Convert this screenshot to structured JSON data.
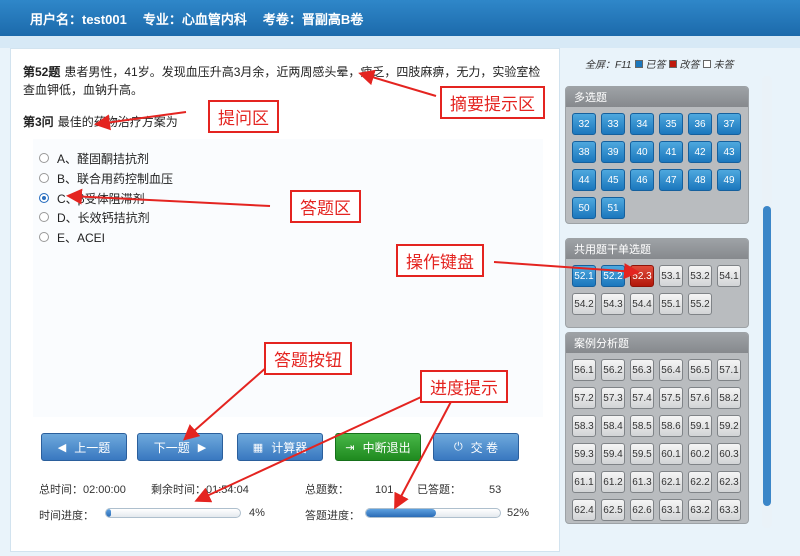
{
  "header": {
    "user": "用户名：test001",
    "major": "专业：心血管内科",
    "exam": "考卷：晋副高B卷"
  },
  "question": {
    "number": "第52题",
    "stem": "患者男性，41岁。发现血压升高3月余，近两周感头晕，疲乏，四肢麻痹，无力，实验室检查血钾低，血钠升高。",
    "sub_number": "第3问",
    "sub_text": "最佳的药物治疗方案为"
  },
  "options": [
    {
      "label": "A、醛固酮拮抗剂",
      "checked": false
    },
    {
      "label": "B、联合用药控制血压",
      "checked": false
    },
    {
      "label": "C、β受体阻滞剂",
      "checked": true
    },
    {
      "label": "D、长效钙拮抗剂",
      "checked": false
    },
    {
      "label": "E、ACEI",
      "checked": false
    }
  ],
  "buttons": {
    "prev": "上一题",
    "next": "下一题",
    "calc": "计算器",
    "pause": "中断退出",
    "submit": "交 卷"
  },
  "stats": {
    "total_time_label": "总时间：",
    "total_time": "02:00:00",
    "remaining_label": "剩余时间：",
    "remaining": "01:54:04",
    "total_q_label": "总题数：",
    "total_q": "101",
    "answered_label": "已答题：",
    "answered": "53",
    "time_progress_label": "时间进度：",
    "time_progress_text": "4%",
    "time_progress": 0.04,
    "answer_progress_label": "答题进度：",
    "answer_progress_text": "52%",
    "answer_progress": 0.52
  },
  "legend": {
    "fullscreen": "全屏：F11",
    "answered": "已答",
    "marked": "改答",
    "unanswered": "未答",
    "color_answered": "#1b77bd",
    "color_marked": "#c0190c",
    "color_unanswered": "#ffffff"
  },
  "groups": [
    {
      "title": "多选题",
      "items": [
        {
          "n": "32",
          "s": "done"
        },
        {
          "n": "33",
          "s": "done"
        },
        {
          "n": "34",
          "s": "done"
        },
        {
          "n": "35",
          "s": "done"
        },
        {
          "n": "36",
          "s": "done"
        },
        {
          "n": "37",
          "s": "done"
        },
        {
          "n": "38",
          "s": "done"
        },
        {
          "n": "39",
          "s": "done"
        },
        {
          "n": "40",
          "s": "done"
        },
        {
          "n": "41",
          "s": "done"
        },
        {
          "n": "42",
          "s": "done"
        },
        {
          "n": "43",
          "s": "done"
        },
        {
          "n": "44",
          "s": "done"
        },
        {
          "n": "45",
          "s": "done"
        },
        {
          "n": "46",
          "s": "done"
        },
        {
          "n": "47",
          "s": "done"
        },
        {
          "n": "48",
          "s": "done"
        },
        {
          "n": "49",
          "s": "done"
        },
        {
          "n": "50",
          "s": "done"
        },
        {
          "n": "51",
          "s": "done"
        }
      ]
    },
    {
      "title": "共用题干单选题",
      "items": [
        {
          "n": "52.1",
          "s": "done"
        },
        {
          "n": "52.2",
          "s": "done"
        },
        {
          "n": "52.3",
          "s": "current"
        },
        {
          "n": "53.1",
          "s": "none"
        },
        {
          "n": "53.2",
          "s": "none"
        },
        {
          "n": "54.1",
          "s": "none"
        },
        {
          "n": "54.2",
          "s": "none"
        },
        {
          "n": "54.3",
          "s": "none"
        },
        {
          "n": "54.4",
          "s": "none"
        },
        {
          "n": "55.1",
          "s": "none"
        },
        {
          "n": "55.2",
          "s": "none"
        }
      ]
    },
    {
      "title": "案例分析题",
      "items": [
        {
          "n": "56.1",
          "s": "none"
        },
        {
          "n": "56.2",
          "s": "none"
        },
        {
          "n": "56.3",
          "s": "none"
        },
        {
          "n": "56.4",
          "s": "none"
        },
        {
          "n": "56.5",
          "s": "none"
        },
        {
          "n": "57.1",
          "s": "none"
        },
        {
          "n": "57.2",
          "s": "none"
        },
        {
          "n": "57.3",
          "s": "none"
        },
        {
          "n": "57.4",
          "s": "none"
        },
        {
          "n": "57.5",
          "s": "none"
        },
        {
          "n": "57.6",
          "s": "none"
        },
        {
          "n": "58.2",
          "s": "none"
        },
        {
          "n": "58.3",
          "s": "none"
        },
        {
          "n": "58.4",
          "s": "none"
        },
        {
          "n": "58.5",
          "s": "none"
        },
        {
          "n": "58.6",
          "s": "none"
        },
        {
          "n": "59.1",
          "s": "none"
        },
        {
          "n": "59.2",
          "s": "none"
        },
        {
          "n": "59.3",
          "s": "none"
        },
        {
          "n": "59.4",
          "s": "none"
        },
        {
          "n": "59.5",
          "s": "none"
        },
        {
          "n": "60.1",
          "s": "none"
        },
        {
          "n": "60.2",
          "s": "none"
        },
        {
          "n": "60.3",
          "s": "none"
        },
        {
          "n": "61.1",
          "s": "none"
        },
        {
          "n": "61.2",
          "s": "none"
        },
        {
          "n": "61.3",
          "s": "none"
        },
        {
          "n": "62.1",
          "s": "none"
        },
        {
          "n": "62.2",
          "s": "none"
        },
        {
          "n": "62.3",
          "s": "none"
        },
        {
          "n": "62.4",
          "s": "none"
        },
        {
          "n": "62.5",
          "s": "none"
        },
        {
          "n": "62.6",
          "s": "none"
        },
        {
          "n": "63.1",
          "s": "none"
        },
        {
          "n": "63.2",
          "s": "none"
        },
        {
          "n": "63.3",
          "s": "none"
        }
      ]
    }
  ],
  "annotations": {
    "summary": "摘要提示区",
    "ask": "提问区",
    "answer": "答题区",
    "keyboard": "操作键盘",
    "buttons": "答题按钮",
    "progress": "进度提示"
  }
}
